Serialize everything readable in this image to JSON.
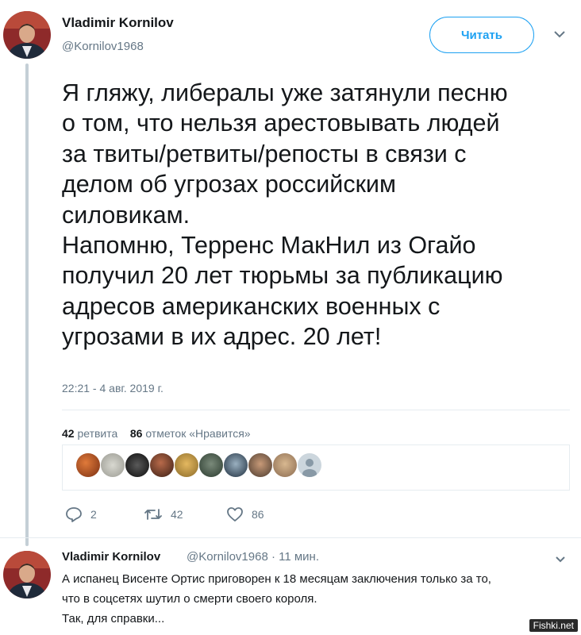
{
  "tweet": {
    "author_name": "Vladimir Kornilov",
    "author_handle": "@Kornilov1968",
    "follow_label": "Читать",
    "text_lines": [
      "Я гляжу, либералы уже затянули песню",
      "о том, что нельзя арестовывать людей",
      "за твиты/ретвиты/репосты в связи с",
      "делом об угрозах российским",
      "силовикам.",
      "Напомню, Терренс МакНил из Огайо",
      "получил 20 лет тюрьмы за публикацию",
      "адресов американских военных с",
      "угрозами в их адрес. 20 лет!"
    ],
    "timestamp": "22:21 - 4 авг. 2019 г.",
    "retweet_count": "42",
    "retweet_label": "ретвита",
    "like_count": "86",
    "like_label": "отметок «Нравится»",
    "actions": {
      "reply_count": "2",
      "retweet_count": "42",
      "like_count": "86"
    }
  },
  "reply": {
    "author_name": "Vladimir Kornilov",
    "meta": "@Kornilov1968 · 11 мин.",
    "lines": [
      "А испанец Висенте Ортис приговорен к 18 месяцам заключения только за то,",
      "что в соцсетях шутил о смерти своего короля.",
      "Так, для справки..."
    ]
  },
  "watermark": "Fishki.net",
  "colors": {
    "accent": "#1da1f2",
    "muted": "#657786",
    "thread_line": "#c4cfd6"
  }
}
